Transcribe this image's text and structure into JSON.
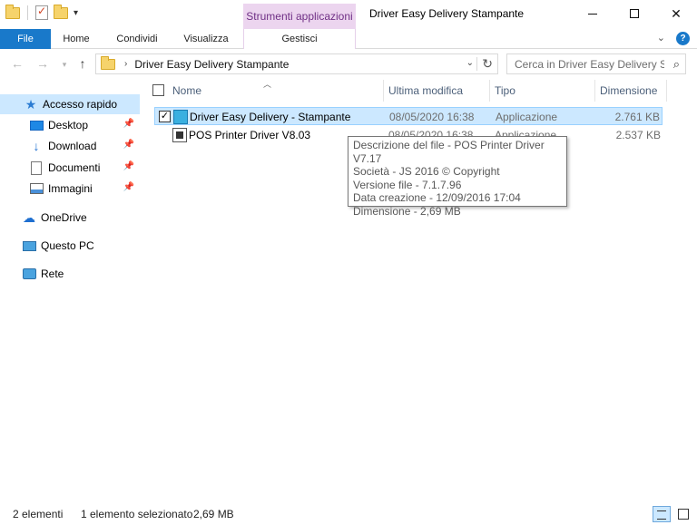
{
  "window": {
    "title": "Driver Easy Delivery Stampante",
    "contextual_tab_group": "Strumenti applicazioni"
  },
  "ribbon": {
    "tabs": [
      "File",
      "Home",
      "Condividi",
      "Visualizza",
      "Gestisci"
    ],
    "accent_color": "#1979ca",
    "contextual_color": "#ecd5ef"
  },
  "address": {
    "path": "Driver Easy Delivery Stampante",
    "search_placeholder": "Cerca in Driver Easy Delivery S..."
  },
  "navpane": {
    "items": [
      {
        "label": "Accesso rapido",
        "icon": "star-icon",
        "selected": true
      },
      {
        "label": "Desktop",
        "icon": "desktop-icon",
        "pinned": true
      },
      {
        "label": "Download",
        "icon": "download-icon",
        "pinned": true
      },
      {
        "label": "Documenti",
        "icon": "documents-icon",
        "pinned": true
      },
      {
        "label": "Immagini",
        "icon": "pictures-icon",
        "pinned": true
      },
      {
        "label": "OneDrive",
        "icon": "cloud-icon"
      },
      {
        "label": "Questo PC",
        "icon": "computer-icon"
      },
      {
        "label": "Rete",
        "icon": "network-icon"
      }
    ]
  },
  "filelist": {
    "columns": [
      "Nome",
      "Ultima modifica",
      "Tipo",
      "Dimensione"
    ],
    "rows": [
      {
        "name": "Driver Easy Delivery - Stampante",
        "date": "08/05/2020 16:38",
        "type": "Applicazione",
        "size": "2.761 KB",
        "selected": true,
        "checked": true
      },
      {
        "name": "POS Printer Driver V8.03",
        "date": "08/05/2020 16:38",
        "type": "Applicazione",
        "size": "2.537 KB",
        "selected": false
      }
    ]
  },
  "tooltip": {
    "lines": [
      "Descrizione del file - POS Printer Driver V7.17",
      "Società - JS 2016 © Copyright",
      "Versione file - 7.1.7.96",
      "Data creazione - 12/09/2016 17:04",
      "Dimensione - 2,69 MB"
    ]
  },
  "status": {
    "count": "2 elementi",
    "selection": "1 elemento selezionato",
    "size": "2,69 MB"
  }
}
